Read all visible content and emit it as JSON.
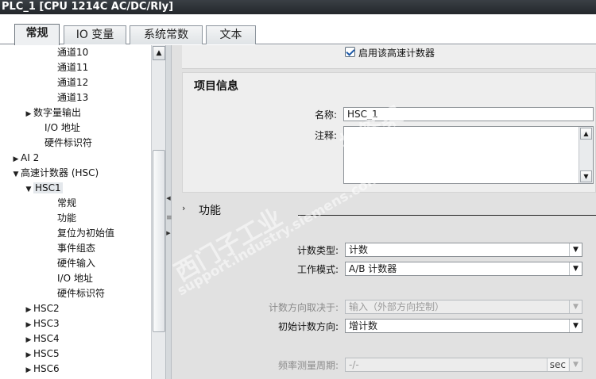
{
  "window": {
    "title": "PLC_1 [CPU 1214C AC/DC/Rly]"
  },
  "tabs": [
    {
      "label": "常规",
      "active": true
    },
    {
      "label": "IO 变量",
      "active": false
    },
    {
      "label": "系统常数",
      "active": false
    },
    {
      "label": "文本",
      "active": false
    }
  ],
  "tree": {
    "items": [
      {
        "label": "通道10",
        "indent": 3,
        "arrow": ""
      },
      {
        "label": "通道11",
        "indent": 3,
        "arrow": ""
      },
      {
        "label": "通道12",
        "indent": 3,
        "arrow": ""
      },
      {
        "label": "通道13",
        "indent": 3,
        "arrow": ""
      },
      {
        "label": "数字量输出",
        "indent": 1,
        "arrow": "right"
      },
      {
        "label": "I/O 地址",
        "indent": 2,
        "arrow": ""
      },
      {
        "label": "硬件标识符",
        "indent": 2,
        "arrow": ""
      },
      {
        "label": "AI 2",
        "indent": 0,
        "arrow": "right"
      },
      {
        "label": "高速计数器 (HSC)",
        "indent": 0,
        "arrow": "down"
      },
      {
        "label": "HSC1",
        "indent": 1,
        "arrow": "down",
        "selected": true
      },
      {
        "label": "常规",
        "indent": 3,
        "arrow": ""
      },
      {
        "label": "功能",
        "indent": 3,
        "arrow": ""
      },
      {
        "label": "复位为初始值",
        "indent": 3,
        "arrow": ""
      },
      {
        "label": "事件组态",
        "indent": 3,
        "arrow": ""
      },
      {
        "label": "硬件输入",
        "indent": 3,
        "arrow": ""
      },
      {
        "label": "I/O 地址",
        "indent": 3,
        "arrow": ""
      },
      {
        "label": "硬件标识符",
        "indent": 3,
        "arrow": ""
      },
      {
        "label": "HSC2",
        "indent": 1,
        "arrow": "right"
      },
      {
        "label": "HSC3",
        "indent": 1,
        "arrow": "right"
      },
      {
        "label": "HSC4",
        "indent": 1,
        "arrow": "right"
      },
      {
        "label": "HSC5",
        "indent": 1,
        "arrow": "right"
      },
      {
        "label": "HSC6",
        "indent": 1,
        "arrow": "right"
      }
    ]
  },
  "enable_checkbox": {
    "label": "启用该高速计数器",
    "checked": true
  },
  "project_info": {
    "title": "项目信息",
    "name_label": "名称:",
    "name_value": "HSC_1",
    "comment_label": "注释:",
    "comment_value": ""
  },
  "function": {
    "title": "功能",
    "counter_type_label": "计数类型:",
    "counter_type_value": "计数",
    "work_mode_label": "工作模式:",
    "work_mode_value": "A/B 计数器",
    "count_dir_label": "计数方向取决于:",
    "count_dir_value": "输入（外部方向控制）",
    "init_dir_label": "初始计数方向:",
    "init_dir_value": "增计数",
    "freq_period_label": "频率测量周期:",
    "freq_period_value": "-/-",
    "freq_period_unit": "sec"
  },
  "watermark": {
    "line1": "西门子工业",
    "line2": "support.industry.siemens.com/cs",
    "line3": "找答案"
  },
  "colors": {
    "accent": "#1e5aa8",
    "panel": "#eeeeee",
    "background": "#e1e1e1"
  }
}
